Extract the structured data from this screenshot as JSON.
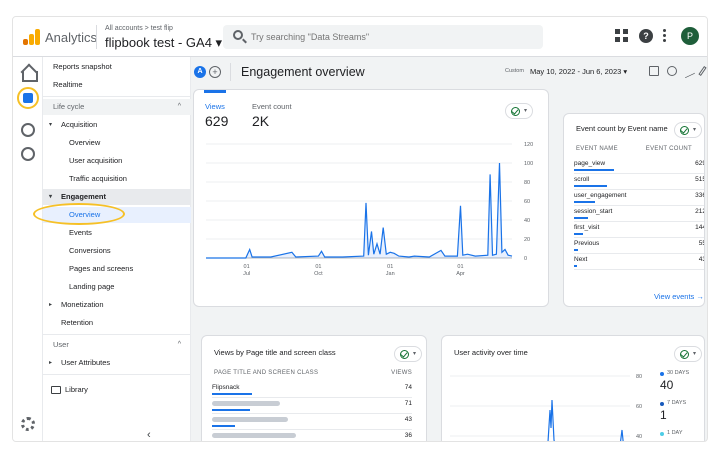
{
  "header": {
    "app_name": "Analytics",
    "breadcrumb": "All accounts > test flip",
    "property": "flipbook test - GA4 ▾",
    "search_placeholder": "Try searching \"Data Streams\"",
    "avatar_letter": "P",
    "help_glyph": "?"
  },
  "nav": {
    "reports_snapshot": "Reports snapshot",
    "realtime": "Realtime",
    "lifecycle": "Life cycle",
    "acquisition": "Acquisition",
    "acq_overview": "Overview",
    "user_acquisition": "User acquisition",
    "traffic_acquisition": "Traffic acquisition",
    "engagement": "Engagement",
    "eng_overview": "Overview",
    "events": "Events",
    "conversions": "Conversions",
    "pages_and_screens": "Pages and screens",
    "landing_page": "Landing page",
    "monetization": "Monetization",
    "retention": "Retention",
    "user": "User",
    "user_attributes": "User Attributes",
    "library": "Library",
    "collapse_glyph": "‹",
    "chevron_up": "^",
    "tri_down": "▾",
    "tri_right": "▸"
  },
  "toolbar": {
    "badge_a": "A",
    "badge_plus": "+",
    "title": "Engagement overview",
    "custom_label": "Custom",
    "date_range": "May 10, 2022 - Jun 6, 2023 ▾"
  },
  "views_card": {
    "views_label": "Views",
    "views_value": "629",
    "events_label": "Event count",
    "events_value": "2K",
    "y_ticks": [
      "120",
      "100",
      "80",
      "60",
      "40",
      "20",
      "0"
    ],
    "x_ticks": [
      {
        "d": "01",
        "m": "Jul"
      },
      {
        "d": "01",
        "m": "Oct"
      },
      {
        "d": "01",
        "m": "Jan"
      },
      {
        "d": "01",
        "m": "Apr"
      }
    ]
  },
  "event_card": {
    "title": "Event count by Event name",
    "col_name": "EVENT NAME",
    "col_count": "EVENT COUNT",
    "rows": [
      {
        "name": "page_view",
        "value": "629"
      },
      {
        "name": "scroll",
        "value": "515"
      },
      {
        "name": "user_engagement",
        "value": "336"
      },
      {
        "name": "session_start",
        "value": "212"
      },
      {
        "name": "first_visit",
        "value": "144"
      },
      {
        "name": "Previous",
        "value": "55"
      },
      {
        "name": "Next",
        "value": "43"
      }
    ],
    "bar_fractions": [
      1.0,
      0.82,
      0.53,
      0.34,
      0.23,
      0.09,
      0.07
    ],
    "link": "View events →"
  },
  "pages_card": {
    "title": "Views by Page title and screen class",
    "col_name": "PAGE TITLE AND SCREEN CLASS",
    "col_views": "VIEWS",
    "rows": [
      {
        "name": "Flipsnack",
        "value": "74"
      },
      {
        "name": "",
        "value": "71"
      },
      {
        "name": "",
        "value": "43"
      },
      {
        "name": "",
        "value": "36"
      }
    ],
    "bar_fractions": [
      1.0,
      0.96,
      0.58,
      0.49
    ]
  },
  "activity_card": {
    "title": "User activity over time",
    "y_ticks": [
      "80",
      "60",
      "40"
    ],
    "stats": [
      {
        "label": "30 DAYS",
        "value": "40",
        "color": "#1a73e8"
      },
      {
        "label": "7 DAYS",
        "value": "1",
        "color": "#185abc"
      },
      {
        "label": "1 DAY",
        "value": "",
        "color": "#4ecde6"
      }
    ]
  },
  "chart_data": [
    {
      "type": "line",
      "title": "",
      "xlabel": "",
      "ylabel": "",
      "ylim": [
        0,
        120
      ],
      "x_range": [
        "2022-05-10",
        "2023-06-06"
      ],
      "x_tick_labels": [
        "01 Jul",
        "01 Oct",
        "01 Jan",
        "01 Apr"
      ],
      "series": [
        {
          "values": [
            [
              "2022-05-10",
              0
            ],
            [
              "2022-06-30",
              0
            ],
            [
              "2022-07-05",
              9
            ],
            [
              "2022-07-08",
              1
            ],
            [
              "2022-08-01",
              1
            ],
            [
              "2022-08-28",
              6
            ],
            [
              "2022-09-02",
              1
            ],
            [
              "2022-10-01",
              2
            ],
            [
              "2022-10-05",
              7
            ],
            [
              "2022-10-09",
              1
            ],
            [
              "2022-11-01",
              1
            ],
            [
              "2022-11-28",
              2
            ],
            [
              "2022-12-01",
              58
            ],
            [
              "2022-12-04",
              3
            ],
            [
              "2022-12-08",
              28
            ],
            [
              "2022-12-11",
              4
            ],
            [
              "2022-12-15",
              15
            ],
            [
              "2022-12-19",
              4
            ],
            [
              "2022-12-23",
              32
            ],
            [
              "2022-12-27",
              4
            ],
            [
              "2023-01-01",
              6
            ],
            [
              "2023-01-06",
              5
            ],
            [
              "2023-01-12",
              2
            ],
            [
              "2023-01-25",
              1
            ],
            [
              "2023-02-01",
              2
            ],
            [
              "2023-02-20",
              1
            ],
            [
              "2023-03-07",
              8
            ],
            [
              "2023-03-12",
              2
            ],
            [
              "2023-03-28",
              2
            ],
            [
              "2023-04-01",
              55
            ],
            [
              "2023-04-04",
              3
            ],
            [
              "2023-04-10",
              4
            ],
            [
              "2023-04-20",
              2
            ],
            [
              "2023-05-06",
              3
            ],
            [
              "2023-05-09",
              88
            ],
            [
              "2023-05-12",
              3
            ],
            [
              "2023-05-17",
              4
            ],
            [
              "2023-05-21",
              100
            ],
            [
              "2023-05-24",
              6
            ],
            [
              "2023-05-28",
              9
            ],
            [
              "2023-06-01",
              3
            ],
            [
              "2023-06-06",
              2
            ]
          ]
        }
      ]
    }
  ]
}
